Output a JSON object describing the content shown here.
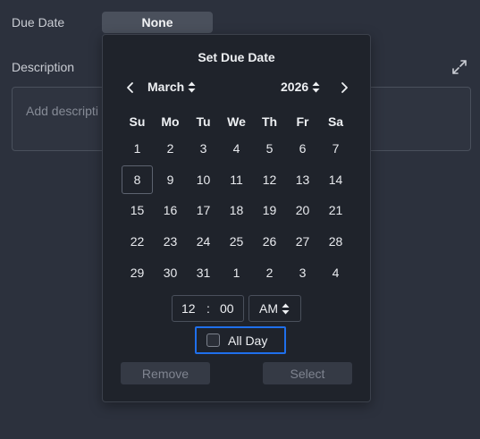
{
  "form": {
    "due_date_label": "Due Date",
    "due_date_value": "None",
    "description_label": "Description",
    "description_placeholder": "Add descripti"
  },
  "picker": {
    "title": "Set Due Date",
    "month": "March",
    "year": "2026",
    "weekdays": [
      "Su",
      "Mo",
      "Tu",
      "We",
      "Th",
      "Fr",
      "Sa"
    ],
    "days": [
      "1",
      "2",
      "3",
      "4",
      "5",
      "6",
      "7",
      "8",
      "9",
      "10",
      "11",
      "12",
      "13",
      "14",
      "15",
      "16",
      "17",
      "18",
      "19",
      "20",
      "21",
      "22",
      "23",
      "24",
      "25",
      "26",
      "27",
      "28",
      "29",
      "30",
      "31",
      "1",
      "2",
      "3",
      "4"
    ],
    "selected_day": "8",
    "hour": "12",
    "time_separator": ":",
    "minute": "00",
    "ampm": "AM",
    "all_day_label": "All Day",
    "all_day_checked": false,
    "remove_label": "Remove",
    "select_label": "Select"
  },
  "colors": {
    "background": "#2c313d",
    "popover": "#1f232b",
    "focus_outline": "#1f6feb"
  },
  "icons": [
    "chevron-left-icon",
    "chevron-right-icon",
    "sort-arrows-icon",
    "expand-icon",
    "checkbox-icon"
  ]
}
